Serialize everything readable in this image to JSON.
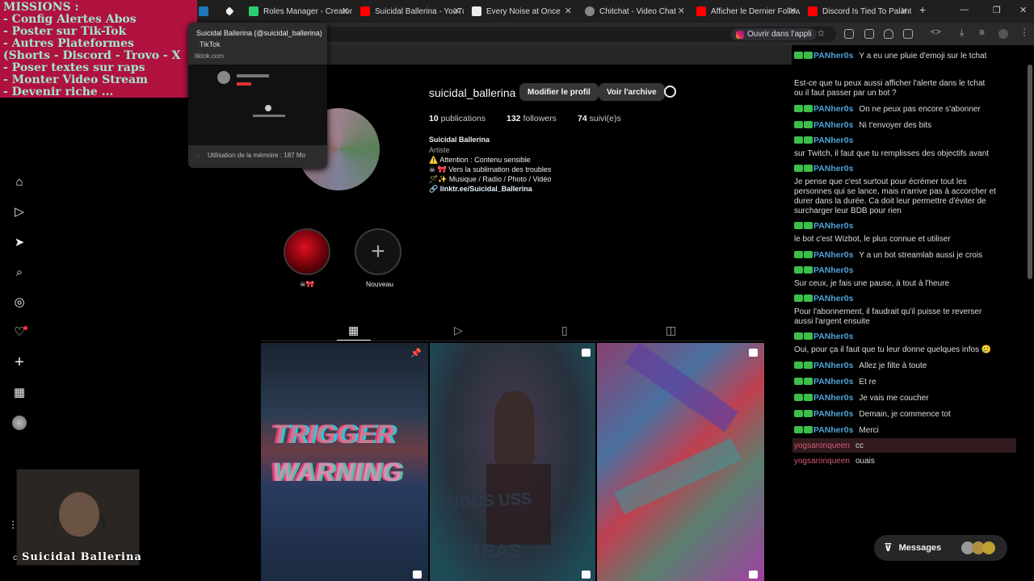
{
  "browser": {
    "tabs": [
      {
        "label": "Roles Manager - Creator S",
        "color": "#2ecc71"
      },
      {
        "label": "Suicidal Ballerina - YouTub",
        "color": "#ff0000"
      },
      {
        "label": "Every Noise at Once",
        "color": "#eeeeee"
      },
      {
        "label": "Chitchat - Video Chat",
        "color": "#cccccc"
      },
      {
        "label": "Afficher le Dernier Follow",
        "color": "#ff0000"
      },
      {
        "label": "Discord Is Tied To Palanti",
        "color": "#ff0000"
      }
    ],
    "open_app": "Ouvrir dans l'appli",
    "tooltip": {
      "title": "Suicidal Ballerina (@suicidal_ballerina)",
      "site": "TikTok",
      "domain": "tiktok.com",
      "memory": "Utilisation de la mémoire : 187 Mo"
    }
  },
  "overlay": {
    "missions": [
      "MISSIONS :",
      "- Config Alertes Abos",
      "- Poster sur Tik-Tok",
      "- Autres Plateformes",
      "(Shorts - Discord - Trovo - X",
      "- Poser textes sur raps",
      "- Monter Video Stream",
      "- Devenir riche ..."
    ],
    "cam_name": "Suicidal Ballerina",
    "cam_prefix": "c"
  },
  "profile": {
    "username": "suicidal_ballerina",
    "edit_label": "Modifier le profil",
    "archive_label": "Voir l'archive",
    "posts": "10",
    "posts_label": "publications",
    "followers": "132",
    "followers_label": "followers",
    "following": "74",
    "following_label": "suivi(e)s",
    "name": "Suicidal Ballerina",
    "category": "Artiste",
    "bio": [
      "⚠️ Attention : Contenu sensible",
      "☠ 🎀 Vers la sublimation des troubles",
      "🪄✨ Musique / Radio / Photo / Vidéo"
    ],
    "link": "linktr.ee/Suicidal_Ballerina",
    "highlights": [
      {
        "label": "☠🎀"
      },
      {
        "label": "Nouveau"
      }
    ],
    "post_texts": [
      "TRIGGER",
      "WARNING",
      "NOUS USS",
      "TEAS"
    ]
  },
  "chat": {
    "messages": [
      {
        "user": "PANher0s",
        "text": "Y a eu une pluie d'emoji sur le tchat",
        "inline": true
      },
      {
        "user": "",
        "text": "Est-ce que tu peux aussi afficher l'alerte dans le tchat",
        "inline": false
      },
      {
        "user": "",
        "text": "ou il faut passer par un bot ?",
        "inline": false
      },
      {
        "user": "PANher0s",
        "text": "On ne peux pas encore s'abonner",
        "inline": true
      },
      {
        "user": "PANher0s",
        "text": "Ni t'envoyer des bits",
        "inline": true
      },
      {
        "user": "PANher0s",
        "text": "",
        "inline": true
      },
      {
        "user": "",
        "text": "sur Twitch, il faut que tu remplisses des objectifs avant",
        "inline": false
      },
      {
        "user": "PANher0s",
        "text": "",
        "inline": true
      },
      {
        "user": "",
        "text": "Je pense que c'est surtout pour écrémer tout les",
        "inline": false
      },
      {
        "user": "",
        "text": "personnes qui se lance, mais n'arrive pas à accorcher et",
        "inline": false
      },
      {
        "user": "",
        "text": "durer dans la durée. Ca doit leur permettre d'éviter de",
        "inline": false
      },
      {
        "user": "",
        "text": "surcharger leur BDB pour rien",
        "inline": false
      },
      {
        "user": "PANher0s",
        "text": "",
        "inline": true
      },
      {
        "user": "",
        "text": "le bot c'est Wizbot, le plus connue et utiliser",
        "inline": false
      },
      {
        "user": "PANher0s",
        "text": "Y a un bot streamlab aussi je crois",
        "inline": true
      },
      {
        "user": "PANher0s",
        "text": "",
        "inline": true
      },
      {
        "user": "",
        "text": "Sur ceux, je fais une pause, à tout à l'heure",
        "inline": false
      },
      {
        "user": "PANher0s",
        "text": "",
        "inline": true
      },
      {
        "user": "",
        "text": "Pour l'abonnement, il faudrait qu'il puisse te reverser",
        "inline": false
      },
      {
        "user": "",
        "text": "aussi l'argent ensuite",
        "inline": false
      },
      {
        "user": "PANher0s",
        "text": "",
        "inline": true
      },
      {
        "user": "",
        "text": "Oui, pour ça il faut que tu leur donne quelques infos 🥲",
        "inline": false
      },
      {
        "user": "PANher0s",
        "text": "Allez je filte à toute",
        "inline": true
      },
      {
        "user": "PANher0s",
        "text": "Et re",
        "inline": true
      },
      {
        "user": "PANher0s",
        "text": "Je vais me coucher",
        "inline": true
      },
      {
        "user": "PANher0s",
        "text": "Demain, je commence tot",
        "inline": true
      },
      {
        "user": "PANher0s",
        "text": "Merci",
        "inline": true
      },
      {
        "user": "yogsaronqueen",
        "text": "cc",
        "inline": true
      },
      {
        "user": "yogsaronqueen",
        "text": "ouais",
        "inline": true
      }
    ],
    "messages_label": "Messages"
  }
}
